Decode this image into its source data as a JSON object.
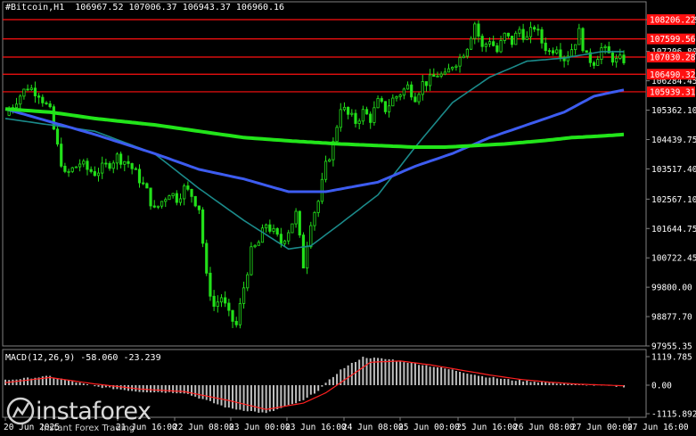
{
  "header": {
    "symbol": "#Bitcoin,H1",
    "ohlc": "106967.52 107006.37 106943.37 106960.16"
  },
  "macd_header": {
    "label": "MACD(12,26,9) -58.060 -23.239"
  },
  "logo": {
    "name": "instaforex",
    "tagline": "Instant Forex Trading"
  },
  "colors": {
    "background": "#000000",
    "candle": "#22e01a",
    "ma_fast": "#1b8a8a",
    "ma_mid": "#3d5cf0",
    "ma_slow": "#22e51a",
    "level": "#ff1010",
    "macd_hist": "#bfbfbf",
    "macd_signal": "#ff2020"
  },
  "chart_data": [
    {
      "type": "candlestick",
      "symbol": "#Bitcoin",
      "timeframe": "H1",
      "y_ticks": [
        "97955.35",
        "98877.70",
        "99800.00",
        "100722.45",
        "101644.75",
        "102567.10",
        "103517.40",
        "104439.75",
        "105362.10",
        "106284.45",
        "107206.80",
        "108206.22"
      ],
      "y_range": [
        97955.35,
        108206.22
      ],
      "x_ticks": [
        "20 Jun 2025",
        "21 Jun 16:00",
        "22 Jun 08:00",
        "23 Jun 00:00",
        "23 Jun 16:00",
        "24 Jun 08:00",
        "25 Jun 00:00",
        "25 Jun 16:00",
        "26 Jun 08:00",
        "27 Jun 00:00",
        "27 Jun 16:00"
      ],
      "close_path": [
        [
          0,
          105200
        ],
        [
          3,
          105700
        ],
        [
          6,
          106100
        ],
        [
          9,
          105900
        ],
        [
          12,
          105300
        ],
        [
          14,
          104200
        ],
        [
          16,
          103300
        ],
        [
          18,
          103500
        ],
        [
          20,
          103700
        ],
        [
          22,
          103500
        ],
        [
          24,
          103400
        ],
        [
          27,
          103600
        ],
        [
          30,
          103900
        ],
        [
          33,
          103700
        ],
        [
          36,
          103200
        ],
        [
          38,
          102800
        ],
        [
          40,
          102200
        ],
        [
          42,
          102500
        ],
        [
          44,
          102800
        ],
        [
          46,
          102600
        ],
        [
          48,
          102900
        ],
        [
          50,
          102700
        ],
        [
          52,
          102300
        ],
        [
          54,
          100100
        ],
        [
          56,
          99200
        ],
        [
          58,
          99500
        ],
        [
          60,
          98900
        ],
        [
          62,
          98600
        ],
        [
          64,
          99800
        ],
        [
          66,
          100900
        ],
        [
          68,
          101200
        ],
        [
          70,
          101800
        ],
        [
          72,
          101500
        ],
        [
          74,
          101200
        ],
        [
          76,
          101600
        ],
        [
          78,
          102100
        ],
        [
          80,
          100500
        ],
        [
          82,
          101900
        ],
        [
          84,
          102500
        ],
        [
          86,
          103600
        ],
        [
          88,
          104300
        ],
        [
          90,
          105500
        ],
        [
          92,
          105200
        ],
        [
          94,
          105000
        ],
        [
          96,
          105300
        ],
        [
          98,
          105100
        ],
        [
          100,
          105600
        ],
        [
          102,
          105400
        ],
        [
          104,
          105700
        ],
        [
          106,
          105900
        ],
        [
          108,
          106100
        ],
        [
          110,
          105800
        ],
        [
          112,
          106200
        ],
        [
          114,
          106300
        ],
        [
          116,
          106500
        ],
        [
          118,
          106400
        ],
        [
          120,
          106800
        ],
        [
          122,
          107000
        ],
        [
          124,
          107400
        ],
        [
          126,
          108100
        ],
        [
          128,
          107300
        ],
        [
          130,
          107600
        ],
        [
          132,
          107200
        ],
        [
          134,
          107700
        ],
        [
          136,
          107500
        ],
        [
          138,
          107900
        ],
        [
          140,
          107600
        ],
        [
          142,
          108000
        ],
        [
          144,
          107500
        ],
        [
          146,
          107200
        ],
        [
          148,
          107400
        ],
        [
          150,
          107000
        ],
        [
          152,
          107300
        ],
        [
          154,
          107800
        ],
        [
          156,
          107000
        ],
        [
          158,
          106900
        ],
        [
          160,
          107300
        ],
        [
          162,
          107100
        ],
        [
          164,
          106900
        ],
        [
          166,
          106960
        ]
      ],
      "moving_averages": [
        {
          "color": "#1b8a8a",
          "points": [
            [
              0,
              105100
            ],
            [
              12,
              104900
            ],
            [
              24,
              104700
            ],
            [
              40,
              104000
            ],
            [
              52,
              102900
            ],
            [
              64,
              101900
            ],
            [
              76,
              101000
            ],
            [
              82,
              101100
            ],
            [
              90,
              101800
            ],
            [
              100,
              102700
            ],
            [
              110,
              104200
            ],
            [
              120,
              105600
            ],
            [
              130,
              106400
            ],
            [
              140,
              106900
            ],
            [
              150,
              107000
            ],
            [
              160,
              107200
            ],
            [
              166,
              107200
            ]
          ]
        },
        {
          "color": "#3d5cf0",
          "points": [
            [
              0,
              105400
            ],
            [
              12,
              105000
            ],
            [
              24,
              104600
            ],
            [
              40,
              104000
            ],
            [
              52,
              103500
            ],
            [
              64,
              103200
            ],
            [
              76,
              102800
            ],
            [
              86,
              102800
            ],
            [
              100,
              103100
            ],
            [
              110,
              103600
            ],
            [
              120,
              104000
            ],
            [
              130,
              104500
            ],
            [
              140,
              104900
            ],
            [
              150,
              105300
            ],
            [
              158,
              105800
            ],
            [
              166,
              106000
            ]
          ]
        },
        {
          "color": "#22e51a",
          "points": [
            [
              0,
              105400
            ],
            [
              12,
              105300
            ],
            [
              24,
              105100
            ],
            [
              40,
              104900
            ],
            [
              52,
              104700
            ],
            [
              64,
              104500
            ],
            [
              76,
              104400
            ],
            [
              90,
              104300
            ],
            [
              100,
              104250
            ],
            [
              110,
              104200
            ],
            [
              118,
              104200
            ],
            [
              126,
              104250
            ],
            [
              134,
              104300
            ],
            [
              144,
              104400
            ],
            [
              152,
              104500
            ],
            [
              160,
              104550
            ],
            [
              166,
              104600
            ]
          ]
        }
      ],
      "horizontal_levels": [
        108206.22,
        107599.56,
        107030.0,
        106490.0,
        105939.31
      ],
      "level_labels": [
        "108206.22",
        "107599.56",
        "107030.28",
        "106490.32",
        "105939.31"
      ]
    },
    {
      "type": "bar",
      "title": "MACD(12,26,9) -58.060 -23.239",
      "y_ticks": [
        "1119.785",
        "0.00",
        "-1115.892"
      ],
      "y_range": [
        -1115.892,
        1119.785
      ],
      "histogram_path": [
        [
          0,
          200
        ],
        [
          12,
          350
        ],
        [
          24,
          -50
        ],
        [
          36,
          -250
        ],
        [
          48,
          -300
        ],
        [
          60,
          -900
        ],
        [
          70,
          -1100
        ],
        [
          80,
          -600
        ],
        [
          84,
          -200
        ],
        [
          90,
          600
        ],
        [
          96,
          1100
        ],
        [
          104,
          1000
        ],
        [
          112,
          800
        ],
        [
          120,
          600
        ],
        [
          128,
          350
        ],
        [
          136,
          200
        ],
        [
          144,
          120
        ],
        [
          152,
          40
        ],
        [
          160,
          -20
        ],
        [
          166,
          -58
        ]
      ],
      "signal_path": [
        [
          0,
          100
        ],
        [
          12,
          300
        ],
        [
          24,
          50
        ],
        [
          36,
          -150
        ],
        [
          48,
          -250
        ],
        [
          60,
          -600
        ],
        [
          70,
          -950
        ],
        [
          80,
          -700
        ],
        [
          86,
          -300
        ],
        [
          92,
          300
        ],
        [
          98,
          900
        ],
        [
          106,
          950
        ],
        [
          114,
          800
        ],
        [
          122,
          600
        ],
        [
          130,
          400
        ],
        [
          138,
          230
        ],
        [
          146,
          120
        ],
        [
          154,
          40
        ],
        [
          162,
          0
        ],
        [
          166,
          -23
        ]
      ]
    }
  ]
}
